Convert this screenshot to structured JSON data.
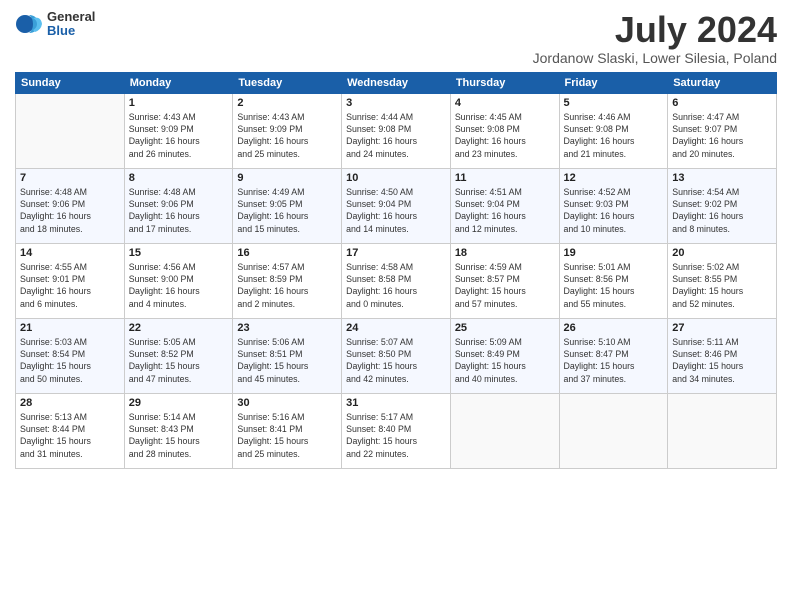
{
  "header": {
    "logo_general": "General",
    "logo_blue": "Blue",
    "month_title": "July 2024",
    "subtitle": "Jordanow Slaski, Lower Silesia, Poland"
  },
  "weekdays": [
    "Sunday",
    "Monday",
    "Tuesday",
    "Wednesday",
    "Thursday",
    "Friday",
    "Saturday"
  ],
  "weeks": [
    [
      {
        "day": "",
        "info": ""
      },
      {
        "day": "1",
        "info": "Sunrise: 4:43 AM\nSunset: 9:09 PM\nDaylight: 16 hours\nand 26 minutes."
      },
      {
        "day": "2",
        "info": "Sunrise: 4:43 AM\nSunset: 9:09 PM\nDaylight: 16 hours\nand 25 minutes."
      },
      {
        "day": "3",
        "info": "Sunrise: 4:44 AM\nSunset: 9:08 PM\nDaylight: 16 hours\nand 24 minutes."
      },
      {
        "day": "4",
        "info": "Sunrise: 4:45 AM\nSunset: 9:08 PM\nDaylight: 16 hours\nand 23 minutes."
      },
      {
        "day": "5",
        "info": "Sunrise: 4:46 AM\nSunset: 9:08 PM\nDaylight: 16 hours\nand 21 minutes."
      },
      {
        "day": "6",
        "info": "Sunrise: 4:47 AM\nSunset: 9:07 PM\nDaylight: 16 hours\nand 20 minutes."
      }
    ],
    [
      {
        "day": "7",
        "info": "Sunrise: 4:48 AM\nSunset: 9:06 PM\nDaylight: 16 hours\nand 18 minutes."
      },
      {
        "day": "8",
        "info": "Sunrise: 4:48 AM\nSunset: 9:06 PM\nDaylight: 16 hours\nand 17 minutes."
      },
      {
        "day": "9",
        "info": "Sunrise: 4:49 AM\nSunset: 9:05 PM\nDaylight: 16 hours\nand 15 minutes."
      },
      {
        "day": "10",
        "info": "Sunrise: 4:50 AM\nSunset: 9:04 PM\nDaylight: 16 hours\nand 14 minutes."
      },
      {
        "day": "11",
        "info": "Sunrise: 4:51 AM\nSunset: 9:04 PM\nDaylight: 16 hours\nand 12 minutes."
      },
      {
        "day": "12",
        "info": "Sunrise: 4:52 AM\nSunset: 9:03 PM\nDaylight: 16 hours\nand 10 minutes."
      },
      {
        "day": "13",
        "info": "Sunrise: 4:54 AM\nSunset: 9:02 PM\nDaylight: 16 hours\nand 8 minutes."
      }
    ],
    [
      {
        "day": "14",
        "info": "Sunrise: 4:55 AM\nSunset: 9:01 PM\nDaylight: 16 hours\nand 6 minutes."
      },
      {
        "day": "15",
        "info": "Sunrise: 4:56 AM\nSunset: 9:00 PM\nDaylight: 16 hours\nand 4 minutes."
      },
      {
        "day": "16",
        "info": "Sunrise: 4:57 AM\nSunset: 8:59 PM\nDaylight: 16 hours\nand 2 minutes."
      },
      {
        "day": "17",
        "info": "Sunrise: 4:58 AM\nSunset: 8:58 PM\nDaylight: 16 hours\nand 0 minutes."
      },
      {
        "day": "18",
        "info": "Sunrise: 4:59 AM\nSunset: 8:57 PM\nDaylight: 15 hours\nand 57 minutes."
      },
      {
        "day": "19",
        "info": "Sunrise: 5:01 AM\nSunset: 8:56 PM\nDaylight: 15 hours\nand 55 minutes."
      },
      {
        "day": "20",
        "info": "Sunrise: 5:02 AM\nSunset: 8:55 PM\nDaylight: 15 hours\nand 52 minutes."
      }
    ],
    [
      {
        "day": "21",
        "info": "Sunrise: 5:03 AM\nSunset: 8:54 PM\nDaylight: 15 hours\nand 50 minutes."
      },
      {
        "day": "22",
        "info": "Sunrise: 5:05 AM\nSunset: 8:52 PM\nDaylight: 15 hours\nand 47 minutes."
      },
      {
        "day": "23",
        "info": "Sunrise: 5:06 AM\nSunset: 8:51 PM\nDaylight: 15 hours\nand 45 minutes."
      },
      {
        "day": "24",
        "info": "Sunrise: 5:07 AM\nSunset: 8:50 PM\nDaylight: 15 hours\nand 42 minutes."
      },
      {
        "day": "25",
        "info": "Sunrise: 5:09 AM\nSunset: 8:49 PM\nDaylight: 15 hours\nand 40 minutes."
      },
      {
        "day": "26",
        "info": "Sunrise: 5:10 AM\nSunset: 8:47 PM\nDaylight: 15 hours\nand 37 minutes."
      },
      {
        "day": "27",
        "info": "Sunrise: 5:11 AM\nSunset: 8:46 PM\nDaylight: 15 hours\nand 34 minutes."
      }
    ],
    [
      {
        "day": "28",
        "info": "Sunrise: 5:13 AM\nSunset: 8:44 PM\nDaylight: 15 hours\nand 31 minutes."
      },
      {
        "day": "29",
        "info": "Sunrise: 5:14 AM\nSunset: 8:43 PM\nDaylight: 15 hours\nand 28 minutes."
      },
      {
        "day": "30",
        "info": "Sunrise: 5:16 AM\nSunset: 8:41 PM\nDaylight: 15 hours\nand 25 minutes."
      },
      {
        "day": "31",
        "info": "Sunrise: 5:17 AM\nSunset: 8:40 PM\nDaylight: 15 hours\nand 22 minutes."
      },
      {
        "day": "",
        "info": ""
      },
      {
        "day": "",
        "info": ""
      },
      {
        "day": "",
        "info": ""
      }
    ]
  ]
}
